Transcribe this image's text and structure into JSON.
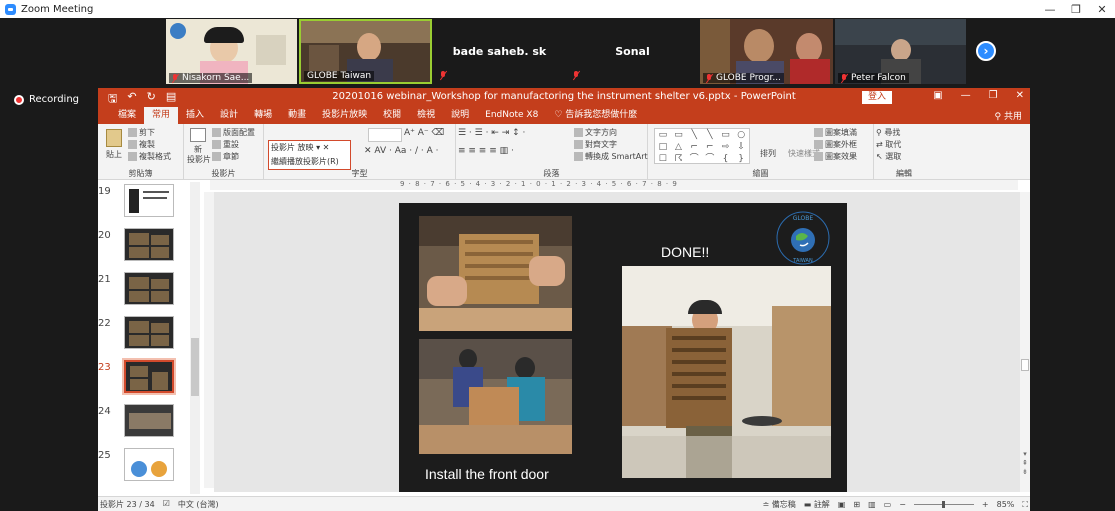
{
  "zoom": {
    "window_title": "Zoom Meeting",
    "recording_label": "Recording",
    "participants": [
      {
        "name": "Nisakorn Sae...",
        "muted": true
      },
      {
        "name": "GLOBE Taiwan",
        "muted": false
      },
      {
        "name": "bade saheb. sk",
        "muted": true
      },
      {
        "name": "Sonal",
        "muted": true
      },
      {
        "name": "GLOBE Progr...",
        "muted": true
      },
      {
        "name": "Peter Falcon",
        "muted": true
      }
    ],
    "next_icon": "chevron-right-icon",
    "brand_color": "#2D8CFF"
  },
  "ppt": {
    "doc_title": "20201016 webinar_Workshop for manufactoring the instrument shelter v6.pptx - PowerPoint",
    "login_label": "登入",
    "share_label": "共用",
    "accent_color": "#C43E1C",
    "tabs": [
      "檔案",
      "常用",
      "插入",
      "設計",
      "轉場",
      "動畫",
      "投影片放映",
      "校閱",
      "檢視",
      "說明",
      "EndNote X8",
      "告訴我您想做什麼"
    ],
    "active_tab": "常用",
    "ribbon": {
      "clipboard": {
        "label": "剪貼簿",
        "paste": "貼上",
        "cut": "剪下",
        "copy": "複製",
        "format_painter": "複製格式"
      },
      "slides": {
        "label": "投影片",
        "new_slide": "新",
        "new_slide_2": "投影片",
        "layout": "版面配置",
        "reset": "重設",
        "section": "章節"
      },
      "popup": {
        "item1": "投影片 放映",
        "item2": "繼續播放投影片(R)"
      },
      "font": {
        "label": "字型"
      },
      "paragraph": {
        "label": "段落",
        "text_direction": "文字方向",
        "align_text": "對齊文字",
        "convert_smartart": "轉換成 SmartArt"
      },
      "drawing": {
        "label": "繪圖",
        "arrange": "排列",
        "quick_styles": "快速樣式",
        "shape_fill": "圖案填滿",
        "shape_outline": "圖案外框",
        "shape_effects": "圖案效果"
      },
      "editing": {
        "label": "編輯",
        "find": "尋找",
        "replace": "取代",
        "select": "選取"
      }
    },
    "thumbnails": [
      {
        "num": "19",
        "current": false
      },
      {
        "num": "20",
        "current": false
      },
      {
        "num": "21",
        "current": false
      },
      {
        "num": "22",
        "current": false
      },
      {
        "num": "23",
        "current": true
      },
      {
        "num": "24",
        "current": false
      },
      {
        "num": "25",
        "current": false
      }
    ],
    "ruler_text": "9 · 8 · 7 · 6 · 5 · 4 · 3 · 2 · 1 · 0 · 1 · 2 · 3 · 4 · 5 · 6 · 7 · 8 · 9",
    "slide": {
      "title": "DONE!!",
      "caption": "Install the front door",
      "logo_text_1": "GLOBE",
      "logo_text_2": "TAIWAN"
    },
    "status": {
      "slide_counter": "投影片 23 / 34",
      "language": "中文 (台灣)",
      "notes": "備忘稿",
      "comments": "註解",
      "zoom": "85%"
    }
  }
}
